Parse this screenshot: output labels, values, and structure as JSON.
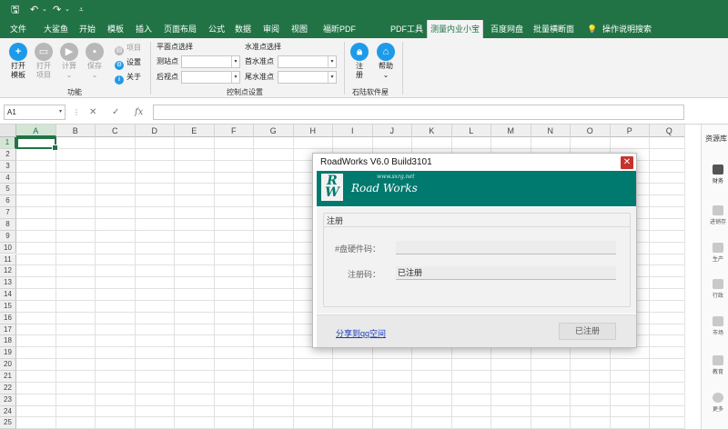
{
  "quick_access": {
    "save_icon": "save-icon",
    "undo_icon": "undo-icon",
    "redo_icon": "redo-icon",
    "customize_icon": "customize-icon"
  },
  "tabs": [
    {
      "label": "文件"
    },
    {
      "label": "大鲨鱼"
    },
    {
      "label": "开始"
    },
    {
      "label": "模板"
    },
    {
      "label": "插入"
    },
    {
      "label": "页面布局"
    },
    {
      "label": "公式"
    },
    {
      "label": "数据"
    },
    {
      "label": "审阅"
    },
    {
      "label": "视图"
    },
    {
      "label": "福昕PDF"
    },
    {
      "label": "PDF工具"
    },
    {
      "label": "测量内业小宝",
      "active": true
    },
    {
      "label": "百度网盘"
    },
    {
      "label": "批量横断面"
    },
    {
      "label": "操作说明搜索"
    }
  ],
  "ribbon": {
    "function_group": {
      "label": "功能",
      "open_template": {
        "line1": "打开",
        "line2": "模板"
      },
      "open_project": {
        "line1": "打开",
        "line2": "项目"
      },
      "calculate": {
        "line1": "计算",
        "line2": "⌄"
      },
      "save": {
        "line1": "保存",
        "line2": "⌄"
      },
      "project": "项目",
      "settings": "设置",
      "about": "关于"
    },
    "control_group": {
      "label": "控制点设置",
      "plane_title": "平面点选择",
      "station_label": "测站点",
      "station_value": "",
      "backsight_label": "后视点",
      "backsight_value": "",
      "level_title": "水准点选择",
      "first_level_label": "首水准点",
      "first_level_value": "",
      "last_level_label": "尾水准点",
      "last_level_value": ""
    },
    "stone_group": {
      "label": "石陆软件屋",
      "register": {
        "line1": "注",
        "line2": "册"
      },
      "help": {
        "line1": "帮助",
        "line2": "⌄"
      }
    }
  },
  "formula_bar": {
    "name_box": "A1",
    "formula": ""
  },
  "grid": {
    "columns": [
      "A",
      "B",
      "C",
      "D",
      "E",
      "F",
      "G",
      "H",
      "I",
      "J",
      "K",
      "L",
      "M",
      "N",
      "O",
      "P",
      "Q"
    ],
    "rows": [
      "1",
      "2",
      "3",
      "4",
      "5",
      "6",
      "7",
      "8",
      "9",
      "10",
      "11",
      "12",
      "13",
      "14",
      "15",
      "16",
      "17",
      "18",
      "19",
      "20",
      "21",
      "22",
      "23",
      "24",
      "25"
    ]
  },
  "side_panel": {
    "title": "资源库",
    "items": [
      {
        "label": "财务"
      },
      {
        "label": "进销存"
      },
      {
        "label": "生产"
      },
      {
        "label": "行政"
      },
      {
        "label": "市场"
      },
      {
        "label": "教育"
      },
      {
        "label": "更多"
      }
    ]
  },
  "dialog": {
    "title": "RoadWorks V6.0 Build3101",
    "close": "✕",
    "banner": {
      "logo_line1": "R",
      "logo_line2": "W",
      "brand": "Road Works",
      "url": "www.sxrg.net"
    },
    "section_title": "注册",
    "hardware_label": "#盘硬件码：",
    "hardware_value": "",
    "regcode_label": "注册码：",
    "regcode_value": "已注册",
    "share_link": "分享到qq空间",
    "status_button": "已注册"
  },
  "colors": {
    "excel_green": "#217346",
    "accent_blue": "#1e9be8",
    "banner_teal": "#007a6e",
    "close_red": "#c7322e"
  }
}
